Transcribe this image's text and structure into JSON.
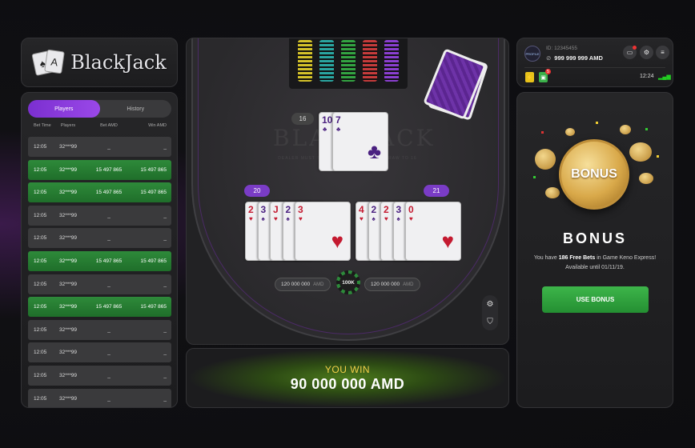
{
  "logo": {
    "text": "BlackJack",
    "card1": "♠",
    "card2": "A"
  },
  "players": {
    "tabs": [
      {
        "label": "Players"
      },
      {
        "label": "History"
      }
    ],
    "columns": [
      "Bet Time",
      "Players",
      "Bet AMD",
      "Win AMD"
    ],
    "rows": [
      {
        "time": "12:05",
        "player": "32***99",
        "bet": "_",
        "win": "_",
        "status": "none"
      },
      {
        "time": "12:05",
        "player": "32***99",
        "bet": "15 497 865",
        "win": "15 497 865",
        "status": "win"
      },
      {
        "time": "12:05",
        "player": "32***99",
        "bet": "15 497 865",
        "win": "15 497 865",
        "status": "win"
      },
      {
        "time": "12:05",
        "player": "32***99",
        "bet": "_",
        "win": "_",
        "status": "none"
      },
      {
        "time": "12:05",
        "player": "32***99",
        "bet": "_",
        "win": "_",
        "status": "none"
      },
      {
        "time": "12:05",
        "player": "32***99",
        "bet": "15 497 865",
        "win": "15 497 865",
        "status": "win"
      },
      {
        "time": "12:05",
        "player": "32***99",
        "bet": "_",
        "win": "_",
        "status": "none"
      },
      {
        "time": "12:05",
        "player": "32***99",
        "bet": "15 497 865",
        "win": "15 497 865",
        "status": "win"
      },
      {
        "time": "12:05",
        "player": "32***99",
        "bet": "_",
        "win": "_",
        "status": "none"
      },
      {
        "time": "12:05",
        "player": "32***99",
        "bet": "_",
        "win": "_",
        "status": "none"
      },
      {
        "time": "12:05",
        "player": "32***99",
        "bet": "_",
        "win": "_",
        "status": "none"
      },
      {
        "time": "12:05",
        "player": "32***99",
        "bet": "_",
        "win": "_",
        "status": "none"
      }
    ]
  },
  "table": {
    "watermark": "BLACKJACK",
    "watermark_sub": "DEALER MUST STAND ON 17, AND MUST DRAW TO 16",
    "dealer": {
      "score": "16",
      "cards": [
        {
          "rank": "10",
          "suit": "♣",
          "color": "purple"
        },
        {
          "rank": "7",
          "suit": "♣",
          "color": "purple"
        }
      ]
    },
    "left_hand": {
      "score": "20",
      "cards": [
        {
          "rank": "2",
          "suit": "♥",
          "color": "red"
        },
        {
          "rank": "3",
          "suit": "♠",
          "color": "purple"
        },
        {
          "rank": "J",
          "suit": "♥",
          "color": "red"
        },
        {
          "rank": "2",
          "suit": "♠",
          "color": "purple"
        },
        {
          "rank": "3",
          "suit": "♥",
          "color": "red"
        }
      ]
    },
    "right_hand": {
      "score": "21",
      "cards": [
        {
          "rank": "4",
          "suit": "♥",
          "color": "red"
        },
        {
          "rank": "2",
          "suit": "♠",
          "color": "purple"
        },
        {
          "rank": "2",
          "suit": "♥",
          "color": "red"
        },
        {
          "rank": "3",
          "suit": "♠",
          "color": "purple"
        },
        {
          "rank": "0",
          "suit": "♥",
          "color": "red"
        }
      ]
    },
    "left_bet": {
      "amount": "120 000 000",
      "currency": "AMD"
    },
    "right_bet": {
      "amount": "120 000 000",
      "currency": "AMD"
    },
    "chip_label": "100K",
    "chip_colors": [
      "#d4c22a",
      "#2aa5a0",
      "#33a342",
      "#c53b3b",
      "#8a3fd0"
    ],
    "side_icons": [
      "gear-icon",
      "shield-icon"
    ]
  },
  "win": {
    "label": "YOU WIN",
    "amount": "90 000 000 AMD"
  },
  "account": {
    "avatar_text": "PROFILE",
    "id": "ID: 12345455",
    "balance": "999 999 999 AMD",
    "time": "12:24",
    "mini_badge": "5"
  },
  "bonus": {
    "coin_text": "BONUS",
    "title": "BONUS",
    "desc_pre": "You have ",
    "desc_bold": "186 Free Bets",
    "desc_post": " in Game Keno Express!",
    "desc_line2": "Available until 01/11/19.",
    "button": "USE BONUS"
  },
  "colors": {
    "accent": "#8a3fd0",
    "win_green": "#2e8a3a",
    "button_green": "#3db54a",
    "gold": "#f3d04a"
  }
}
